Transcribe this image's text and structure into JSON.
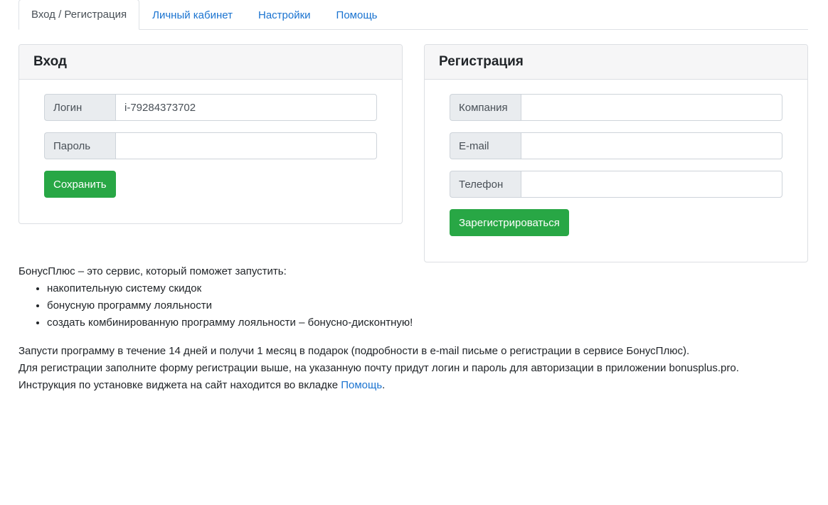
{
  "tabs": [
    {
      "label": "Вход / Регистрация",
      "active": true
    },
    {
      "label": "Личный кабинет",
      "active": false
    },
    {
      "label": "Настройки",
      "active": false
    },
    {
      "label": "Помощь",
      "active": false
    }
  ],
  "login": {
    "title": "Вход",
    "login_label": "Логин",
    "login_value": "i-79284373702",
    "password_label": "Пароль",
    "password_value": "",
    "save_label": "Сохранить"
  },
  "register": {
    "title": "Регистрация",
    "company_label": "Компания",
    "company_value": "",
    "email_label": "E-mail",
    "email_value": "",
    "phone_label": "Телефон",
    "phone_value": "",
    "register_label": "Зарегистрироваться"
  },
  "info": {
    "intro": "БонусПлюс – это сервис, который поможет запустить:",
    "items": [
      "накопительную систему скидок",
      "бонусную программу лояльности",
      "создать комбинированную программу лояльности – бонусно-дисконтную!"
    ],
    "line1": "Запусти программу в течение 14 дней и получи 1 месяц в подарок (подробности в e-mail письме о регистрации в сервисе БонусПлюс).",
    "line2": "Для регистрации заполните форму регистрации выше, на указанную почту придут логин и пароль для авторизации в приложении bonusplus.pro.",
    "line3_prefix": "Инструкция по установке виджета на сайт находится во вкладке ",
    "line3_link": "Помощь",
    "line3_suffix": "."
  },
  "colors": {
    "accent": "#1a73d0",
    "button": "#28a745"
  }
}
